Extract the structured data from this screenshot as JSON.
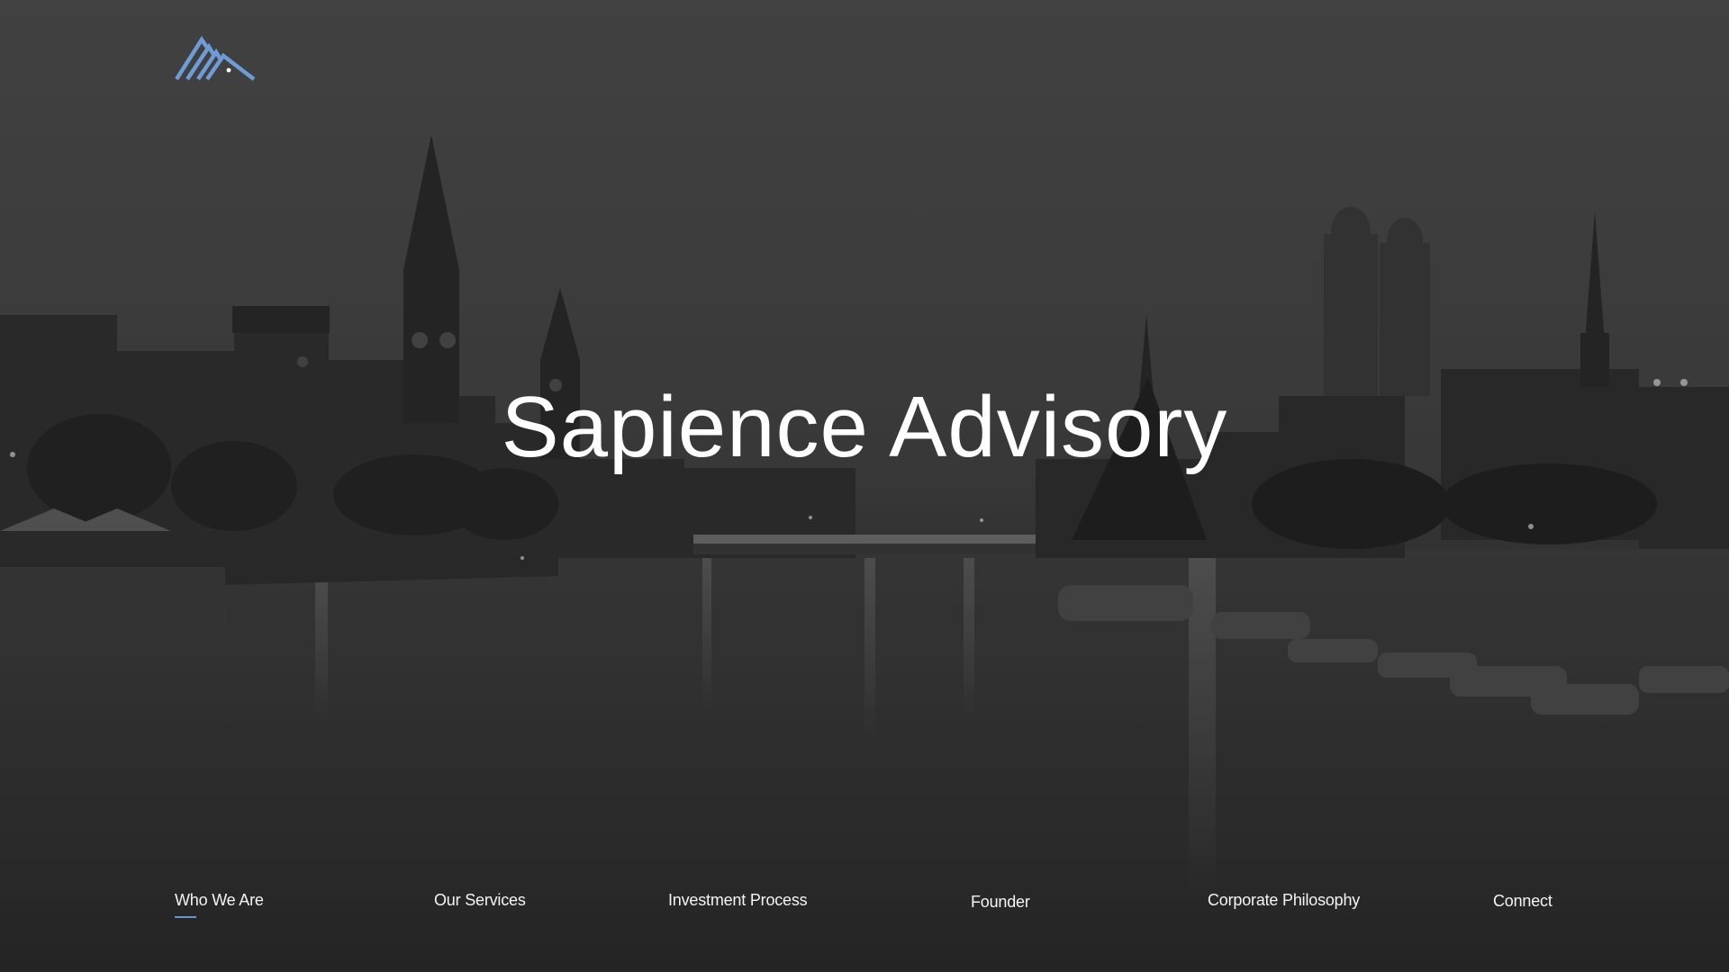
{
  "brand": {
    "name": "Sapience Advisory",
    "logo_icon": "mountain-logo-icon",
    "accent_color": "#6f9bd6"
  },
  "hero": {
    "title": "Sapience Advisory",
    "background": "zurich-river-night-photo"
  },
  "nav": {
    "items": [
      {
        "label": "Who We Are",
        "active": true
      },
      {
        "label": "Our Services",
        "active": false
      },
      {
        "label": "Investment Process",
        "active": false
      },
      {
        "label": "Founder",
        "active": false
      },
      {
        "label": "Corporate Philosophy",
        "active": false
      },
      {
        "label": "Connect",
        "active": false
      }
    ]
  }
}
